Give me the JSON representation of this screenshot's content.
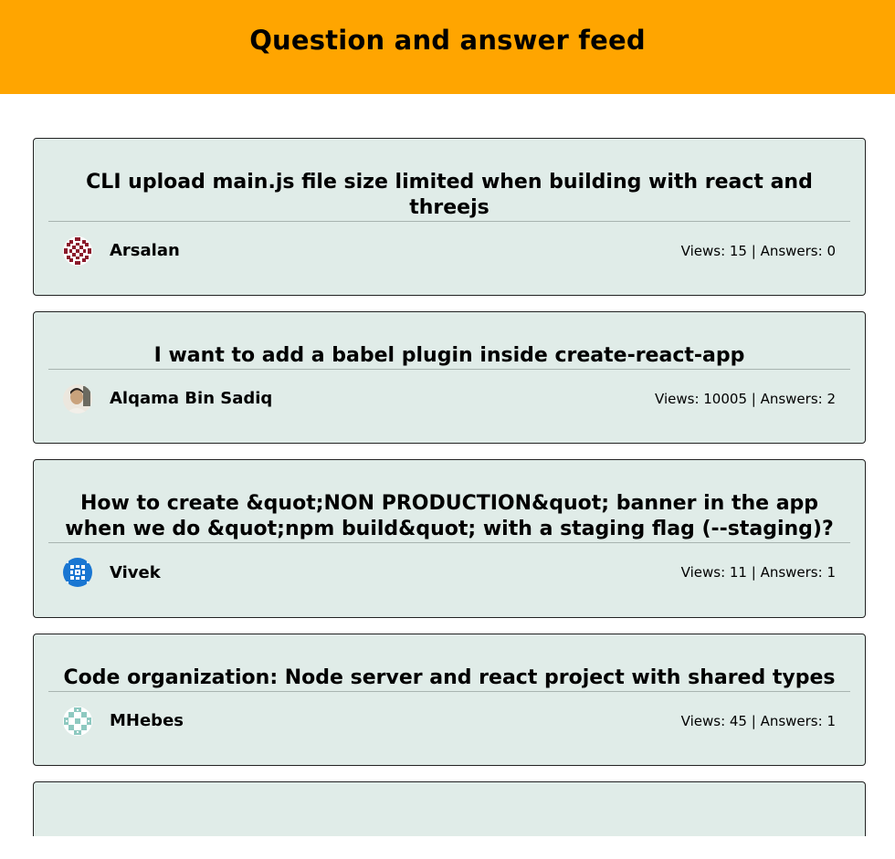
{
  "header": {
    "title": "Question and answer feed"
  },
  "posts": [
    {
      "title": "CLI upload main.js file size limited when building with react and threejs",
      "author": "Arsalan",
      "stats": "Views: 15 | Answers: 0",
      "avatar_icon": "identicon-maroon",
      "avatar_color": "#8b1a2b"
    },
    {
      "title": "I want to add a babel plugin inside create-react-app",
      "author": "Alqama Bin Sadiq",
      "stats": "Views: 10005 | Answers: 2",
      "avatar_icon": "user-photo",
      "avatar_color": "#c9b59a"
    },
    {
      "title": "How to create &quot;NON PRODUCTION&quot; banner in the app when we do &quot;npm build&quot; with a staging flag (--staging)?",
      "author": "Vivek",
      "stats": "Views: 11 | Answers: 1",
      "avatar_icon": "identicon-blue",
      "avatar_color": "#1976d2"
    },
    {
      "title": "Code organization: Node server and react project with shared types",
      "author": "MHebes",
      "stats": "Views: 45 | Answers: 1",
      "avatar_icon": "identicon-teal",
      "avatar_color": "#8ec9c0"
    }
  ],
  "colors": {
    "header_bg": "#ffa500",
    "card_bg": "#e0ece8"
  }
}
